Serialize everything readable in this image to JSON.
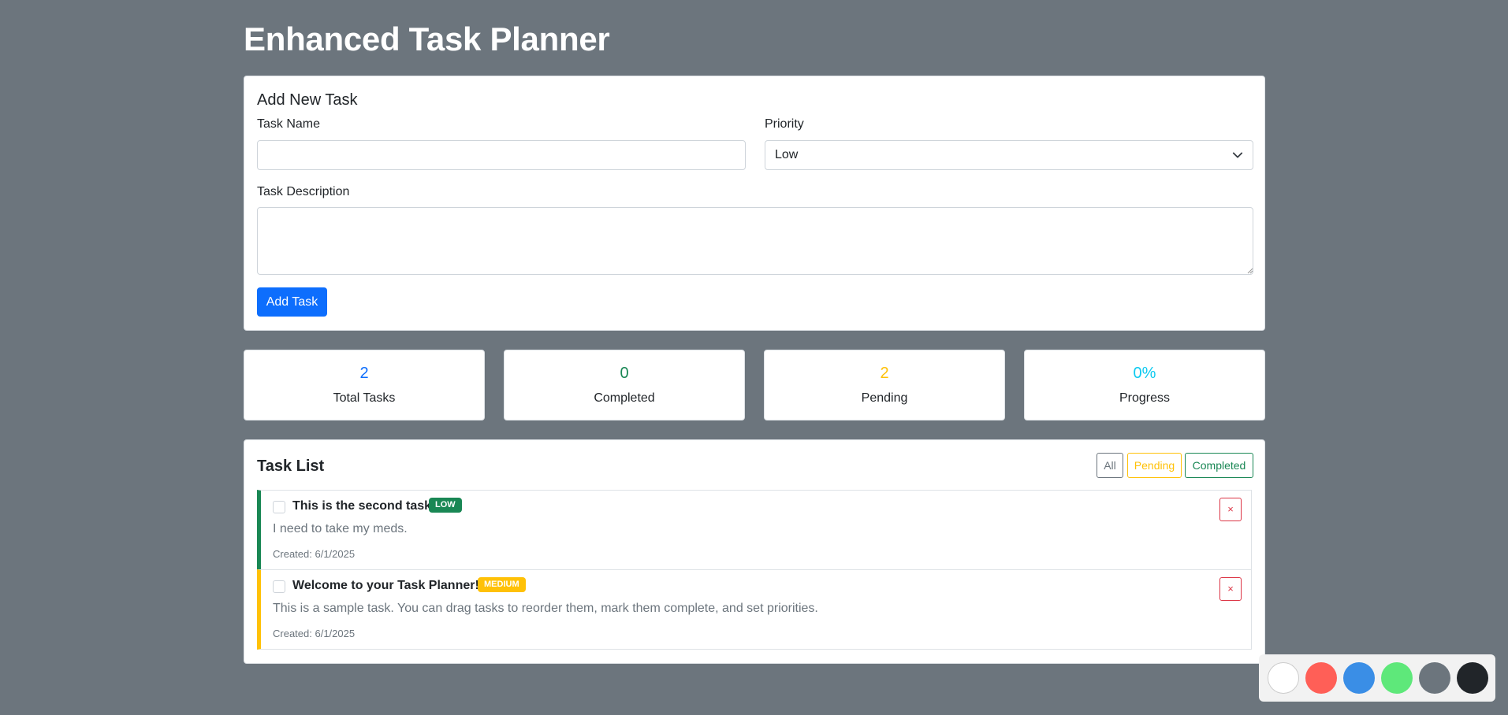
{
  "page": {
    "title": "Enhanced Task Planner"
  },
  "add_task": {
    "heading": "Add New Task",
    "name_label": "Task Name",
    "name_value": "",
    "priority_label": "Priority",
    "priority_value": "Low",
    "description_label": "Task Description",
    "description_value": "",
    "button_label": "Add Task"
  },
  "stats": [
    {
      "value": "2",
      "label": "Total Tasks",
      "color": "#0d6efd"
    },
    {
      "value": "0",
      "label": "Completed",
      "color": "#198754"
    },
    {
      "value": "2",
      "label": "Pending",
      "color": "#ffc107"
    },
    {
      "value": "0%",
      "label": "Progress",
      "color": "#0dcaf0"
    }
  ],
  "task_list": {
    "heading": "Task List",
    "filters": [
      {
        "label": "All",
        "color": "#6c757d"
      },
      {
        "label": "Pending",
        "color": "#ffc107"
      },
      {
        "label": "Completed",
        "color": "#198754"
      }
    ],
    "tasks": [
      {
        "title": "This is the second task",
        "priority": "LOW",
        "priority_color": "#198754",
        "description": "I need to take my meds.",
        "created": "Created: 6/1/2025",
        "completed": false,
        "delete_label": "×"
      },
      {
        "title": "Welcome to your Task Planner!",
        "priority": "MEDIUM",
        "priority_color": "#ffc107",
        "description": "This is a sample task. You can drag tasks to reorder them, mark them complete, and set priorities.",
        "created": "Created: 6/1/2025",
        "completed": false,
        "delete_label": "×"
      }
    ]
  },
  "theme_palette": {
    "colors": [
      {
        "name": "white",
        "hex": "#ffffff"
      },
      {
        "name": "red",
        "hex": "#ff5f57"
      },
      {
        "name": "blue",
        "hex": "#3a8ee6"
      },
      {
        "name": "green",
        "hex": "#5ee87a"
      },
      {
        "name": "gray",
        "hex": "#6c757d"
      },
      {
        "name": "dark",
        "hex": "#212529"
      }
    ]
  }
}
